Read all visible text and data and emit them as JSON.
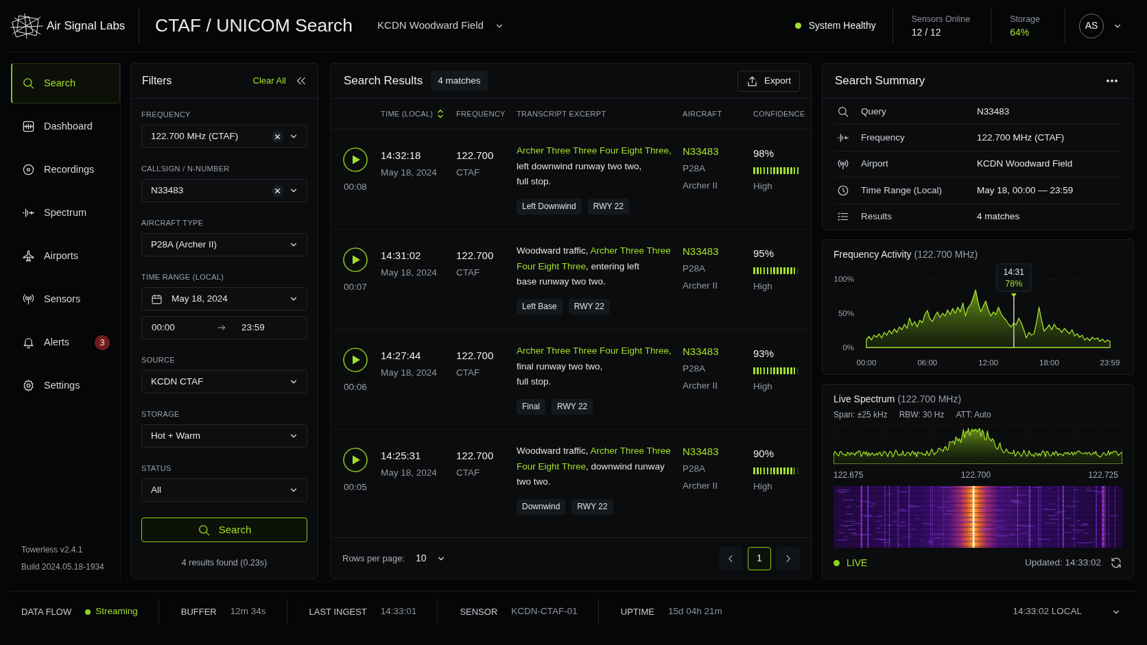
{
  "header": {
    "brand": "Air Signal Labs",
    "title": "CTAF / UNICOM Search",
    "airport": "KCDN Woodward Field",
    "system_status": "System Healthy",
    "stats": [
      {
        "label": "Sensors Online",
        "value": "12 / 12",
        "highlight": false
      },
      {
        "label": "Storage",
        "value": "64%",
        "highlight": true
      }
    ],
    "avatar": "AS"
  },
  "sidebar": {
    "items": [
      {
        "label": "Search",
        "selected": true
      },
      {
        "label": "Dashboard",
        "selected": false
      },
      {
        "label": "Recordings",
        "selected": false
      },
      {
        "label": "Spectrum",
        "selected": false
      },
      {
        "label": "Airports",
        "selected": false
      },
      {
        "label": "Sensors",
        "selected": false
      },
      {
        "label": "Alerts",
        "selected": false,
        "badge": "3"
      },
      {
        "label": "Settings",
        "selected": false
      }
    ],
    "version": "Towerless v2.4.1",
    "build": "Build 2024.05.18-1934"
  },
  "filters": {
    "title": "Filters",
    "clear_all": "Clear All",
    "fields": [
      {
        "kind": "select",
        "label": "FREQUENCY",
        "value": "122.700 MHz (CTAF)",
        "clearable": true
      },
      {
        "kind": "select",
        "label": "CALLSIGN / N-NUMBER",
        "value": "N33483",
        "clearable": true
      },
      {
        "kind": "select",
        "label": "AIRCRAFT TYPE",
        "value": "P28A (Archer II)",
        "clearable": false
      },
      {
        "kind": "date",
        "label": "TIME RANGE (LOCAL)",
        "value": "May 18, 2024"
      },
      {
        "kind": "time_range",
        "from": "00:00",
        "to": "23:59"
      },
      {
        "kind": "select",
        "label": "SOURCE",
        "value": "KCDN CTAF",
        "clearable": false
      },
      {
        "kind": "select",
        "label": "STORAGE",
        "value": "Hot + Warm",
        "clearable": false
      },
      {
        "kind": "select",
        "label": "STATUS",
        "value": "All",
        "clearable": false
      }
    ],
    "search_button": "Search",
    "result_note": "4 results found (0.23s)"
  },
  "results": {
    "title": "Search Results",
    "count": "4 matches",
    "export": "Export",
    "columns": [
      {
        "label": "TIME (LOCAL)",
        "sorted": true
      },
      {
        "label": "FREQUENCY",
        "sorted": false
      },
      {
        "label": "TRANSCRIPT EXCERPT",
        "sorted": false
      },
      {
        "label": "AIRCRAFT",
        "sorted": false
      },
      {
        "label": "CONFIDENCE",
        "sorted": false
      }
    ],
    "rows": [
      {
        "duration": "00:08",
        "time": "14:32:18",
        "date": "May 18, 2024",
        "frequency": "122.700",
        "channel": "CTAF",
        "transcript": [
          {
            "text": "Archer Three Three Four Eight Three,",
            "highlight": true
          },
          {
            "text": "\nleft downwind runway two two,\nfull stop.",
            "highlight": false
          }
        ],
        "tags": [
          "Left Downwind",
          "RWY 22"
        ],
        "callsign": "N33483",
        "type": "P28A",
        "model": "Archer II",
        "confidence": {
          "text": "98%",
          "level": 0.98,
          "rating": "High"
        }
      },
      {
        "duration": "00:07",
        "time": "14:31:02",
        "date": "May 18, 2024",
        "frequency": "122.700",
        "channel": "CTAF",
        "transcript": [
          {
            "text": "Woodward traffic, ",
            "highlight": false
          },
          {
            "text": "Archer Three Three\nFour Eight Three",
            "highlight": true
          },
          {
            "text": ", entering left\nbase runway two two.",
            "highlight": false
          }
        ],
        "tags": [
          "Left Base",
          "RWY 22"
        ],
        "callsign": "N33483",
        "type": "P28A",
        "model": "Archer II",
        "confidence": {
          "text": "95%",
          "level": 0.95,
          "rating": "High"
        }
      },
      {
        "duration": "00:06",
        "time": "14:27:44",
        "date": "May 18, 2024",
        "frequency": "122.700",
        "channel": "CTAF",
        "transcript": [
          {
            "text": "Archer Three Three Four Eight Three,",
            "highlight": true
          },
          {
            "text": "\nfinal runway two two,\nfull stop.",
            "highlight": false
          }
        ],
        "tags": [
          "Final",
          "RWY 22"
        ],
        "callsign": "N33483",
        "type": "P28A",
        "model": "Archer II",
        "confidence": {
          "text": "93%",
          "level": 0.93,
          "rating": "High"
        }
      },
      {
        "duration": "00:05",
        "time": "14:25:31",
        "date": "May 18, 2024",
        "frequency": "122.700",
        "channel": "CTAF",
        "transcript": [
          {
            "text": "Woodward traffic, ",
            "highlight": false
          },
          {
            "text": "Archer Three Three\nFour Eight Three",
            "highlight": true
          },
          {
            "text": ", downwind runway\ntwo two.",
            "highlight": false
          }
        ],
        "tags": [
          "Downwind",
          "RWY 22"
        ],
        "callsign": "N33483",
        "type": "P28A",
        "model": "Archer II",
        "confidence": {
          "text": "90%",
          "level": 0.9,
          "rating": "High"
        }
      }
    ],
    "rows_per_page_label": "Rows per page:",
    "rows_per_page": "10",
    "pages": [
      {
        "label": "1",
        "selected": true
      }
    ]
  },
  "summary": {
    "title": "Search Summary",
    "rows": [
      {
        "label": "Query",
        "value": "N33483"
      },
      {
        "label": "Frequency",
        "value": "122.700 MHz (CTAF)"
      },
      {
        "label": "Airport",
        "value": "KCDN Woodward Field"
      },
      {
        "label": "Time Range (Local)",
        "value": "May 18, 00:00 — 23:59"
      },
      {
        "label": "Results",
        "value": "4 matches"
      }
    ]
  },
  "activity": {
    "title": "Frequency Activity",
    "subtitle": "(122.700 MHz)",
    "tooltip_time": "14:31",
    "chart_data": {
      "type": "area",
      "x": [
        0,
        0.25,
        0.5,
        0.75,
        1,
        1.25,
        1.5,
        1.75,
        2,
        2.25,
        2.5,
        2.75,
        3,
        3.25,
        3.5,
        3.75,
        4,
        4.25,
        4.5,
        4.75,
        5,
        5.25,
        5.5,
        5.75,
        6,
        6.25,
        6.5,
        6.75,
        7,
        7.25,
        7.5,
        7.75,
        8,
        8.25,
        8.5,
        8.75,
        9,
        9.25,
        9.5,
        9.75,
        10,
        10.25,
        10.5,
        10.75,
        11,
        11.25,
        11.5,
        11.75,
        12,
        12.25,
        12.5,
        12.75,
        13,
        13.25,
        13.5,
        13.75,
        14,
        14.25,
        14.5,
        14.75,
        15,
        15.25,
        15.5,
        15.75,
        16,
        16.25,
        16.5,
        16.75,
        17,
        17.25,
        17.5,
        17.75,
        18,
        18.25,
        18.5,
        18.75,
        19,
        19.25,
        19.5,
        19.75,
        20,
        20.25,
        20.5,
        20.75,
        21,
        21.25,
        21.5,
        21.75,
        22,
        22.25,
        22.5,
        22.75,
        23,
        23.25,
        23.5,
        23.75,
        23.983
      ],
      "values": [
        12,
        16,
        11,
        18,
        15,
        20,
        14,
        22,
        18,
        25,
        20,
        27,
        22,
        30,
        26,
        34,
        28,
        43,
        32,
        38,
        30,
        40,
        36,
        48,
        54,
        42,
        38,
        46,
        52,
        44,
        50,
        46,
        55,
        48,
        57,
        50,
        59,
        52,
        65,
        46,
        58,
        62,
        72,
        84,
        66,
        52,
        60,
        68,
        55,
        46,
        52,
        48,
        59,
        50,
        44,
        40,
        34,
        30,
        36,
        33,
        43,
        36,
        26,
        14,
        22,
        18,
        20,
        36,
        59,
        40,
        24,
        28,
        33,
        26,
        34,
        28,
        27,
        22,
        28,
        24,
        20,
        26,
        17,
        20,
        15,
        18,
        11,
        14,
        10,
        15,
        12,
        14,
        9,
        12,
        8,
        11,
        9
      ],
      "xlim": [
        0,
        23.983
      ],
      "ylim": [
        0,
        100
      ],
      "xticks": [
        {
          "value": 0,
          "label": "00:00"
        },
        {
          "value": 6,
          "label": "06:00"
        },
        {
          "value": 12,
          "label": "12:00"
        },
        {
          "value": 18,
          "label": "18:00"
        },
        {
          "value": 23.983,
          "label": "23:59"
        }
      ],
      "yticks": [
        {
          "value": 0,
          "label": "0%"
        },
        {
          "value": 50,
          "label": "50%"
        },
        {
          "value": 100,
          "label": "100%"
        }
      ],
      "grid": true,
      "annotations": [
        {
          "x": 14.517,
          "y": 78,
          "text": "78%"
        }
      ]
    }
  },
  "spectrum": {
    "title": "Live Spectrum",
    "subtitle": "(122.700 MHz)",
    "params": [
      "Span: ±25 kHz",
      "RBW: 30 Hz",
      "ATT: Auto"
    ],
    "axis_labels": [
      "122.675",
      "122.700",
      "122.725"
    ],
    "live": "LIVE",
    "updated": "Updated: 14:33:02"
  },
  "status_bar": {
    "items": [
      {
        "kind": "status",
        "label": "DATA FLOW",
        "value": "Streaming"
      },
      {
        "kind": "plain",
        "label": "BUFFER",
        "value": "12m 34s"
      },
      {
        "kind": "plain",
        "label": "LAST INGEST",
        "value": "14:33:01"
      },
      {
        "kind": "plain",
        "label": "SENSOR",
        "value": "KCDN-CTAF-01"
      },
      {
        "kind": "plain",
        "label": "UPTIME",
        "value": "15d 04h 21m"
      }
    ],
    "clock": "14:33:02 LOCAL"
  }
}
